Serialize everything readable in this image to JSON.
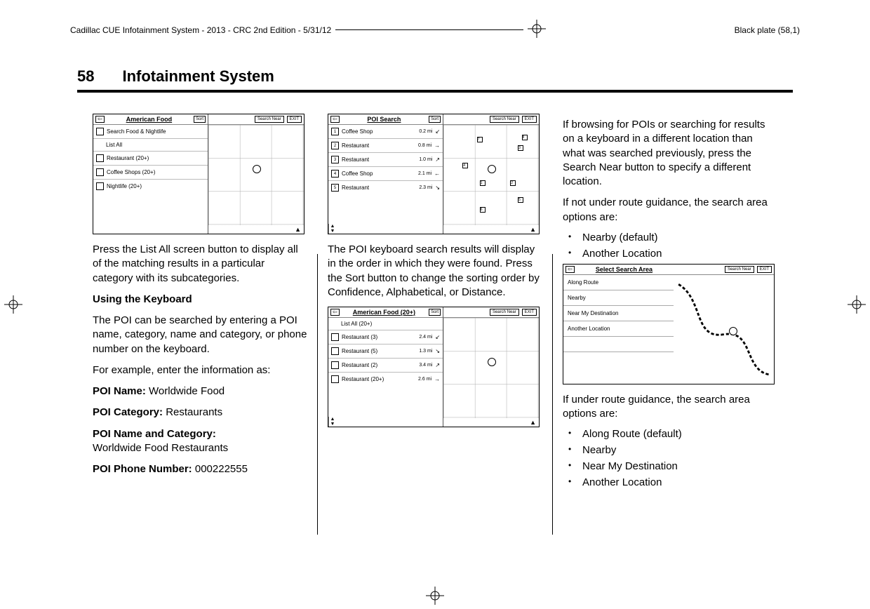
{
  "header": {
    "doc_title": "Cadillac CUE Infotainment System - 2013 - CRC 2nd Edition - 5/31/12",
    "plate": "Black plate (58,1)"
  },
  "page": {
    "number": "58",
    "title": "Infotainment System"
  },
  "col1": {
    "screen1": {
      "title": "American Food",
      "sort": "Sort",
      "rows": [
        "Search Food & Nightlife",
        "List All",
        "Restaurant (20+)",
        "Coffee Shops (20+)",
        "Nightlife (20+)"
      ],
      "search_near": "Search Near",
      "exit": "EXIT"
    },
    "p1": "Press the List All screen button to display all of the matching results in a particular category with its subcategories.",
    "h1": "Using the Keyboard",
    "p2": "The POI can be searched by entering a POI name, category, name and category, or phone number on the keyboard.",
    "p3": "For example, enter the information as:",
    "poi_name_label": "POI Name:",
    "poi_name_val": " Worldwide Food",
    "poi_cat_label": "POI Category:",
    "poi_cat_val": " Restaurants",
    "poi_name_cat_label": "POI Name and Category:",
    "poi_name_cat_val": "Worldwide Food Restaurants",
    "poi_phone_label": "POI Phone Number:",
    "poi_phone_val": " 000222555"
  },
  "col2": {
    "screen1": {
      "title": "POI Search",
      "sort": "Sort",
      "search_near": "Search Near",
      "exit": "EXIT",
      "rows": [
        {
          "n": "1",
          "name": "Coffee Shop",
          "dist": "0.2 mi"
        },
        {
          "n": "2",
          "name": "Restaurant",
          "dist": "0.8 mi"
        },
        {
          "n": "3",
          "name": "Restaurant",
          "dist": "1.0 mi"
        },
        {
          "n": "4",
          "name": "Coffee Shop",
          "dist": "2.1 mi"
        },
        {
          "n": "5",
          "name": "Restaurant",
          "dist": "2.3 mi"
        }
      ]
    },
    "p1": "The POI keyboard search results will display in the order in which they were found. Press the Sort button to change the sorting order by Confidence, Alphabetical, or Distance.",
    "screen2": {
      "title": "American Food (20+)",
      "sort": "Sort",
      "search_near": "Search Near",
      "exit": "EXIT",
      "top": "List All (20+)",
      "rows": [
        {
          "name": "Restaurant (3)",
          "dist": "2.4 mi"
        },
        {
          "name": "Restaurant (5)",
          "dist": "1.3 mi"
        },
        {
          "name": "Restaurant (2)",
          "dist": "3.4 mi"
        },
        {
          "name": "Restaurant (20+)",
          "dist": "2.6 mi"
        }
      ]
    }
  },
  "col3": {
    "p1": "If browsing for POIs or searching for results on a keyboard in a different location than what was searched previously, press the Search Near button to specify a different location.",
    "p2": "If not under route guidance, the search area options are:",
    "list1": [
      "Nearby (default)",
      "Another Location"
    ],
    "screen": {
      "title": "Select Search Area",
      "search_near": "Search Near",
      "exit": "EXIT",
      "rows": [
        "Along Route",
        "Nearby",
        "Near My Destination",
        "Another Location"
      ]
    },
    "p3": "If under route guidance, the search area options are:",
    "list2": [
      "Along Route (default)",
      "Nearby",
      "Near My Destination",
      "Another Location"
    ]
  }
}
